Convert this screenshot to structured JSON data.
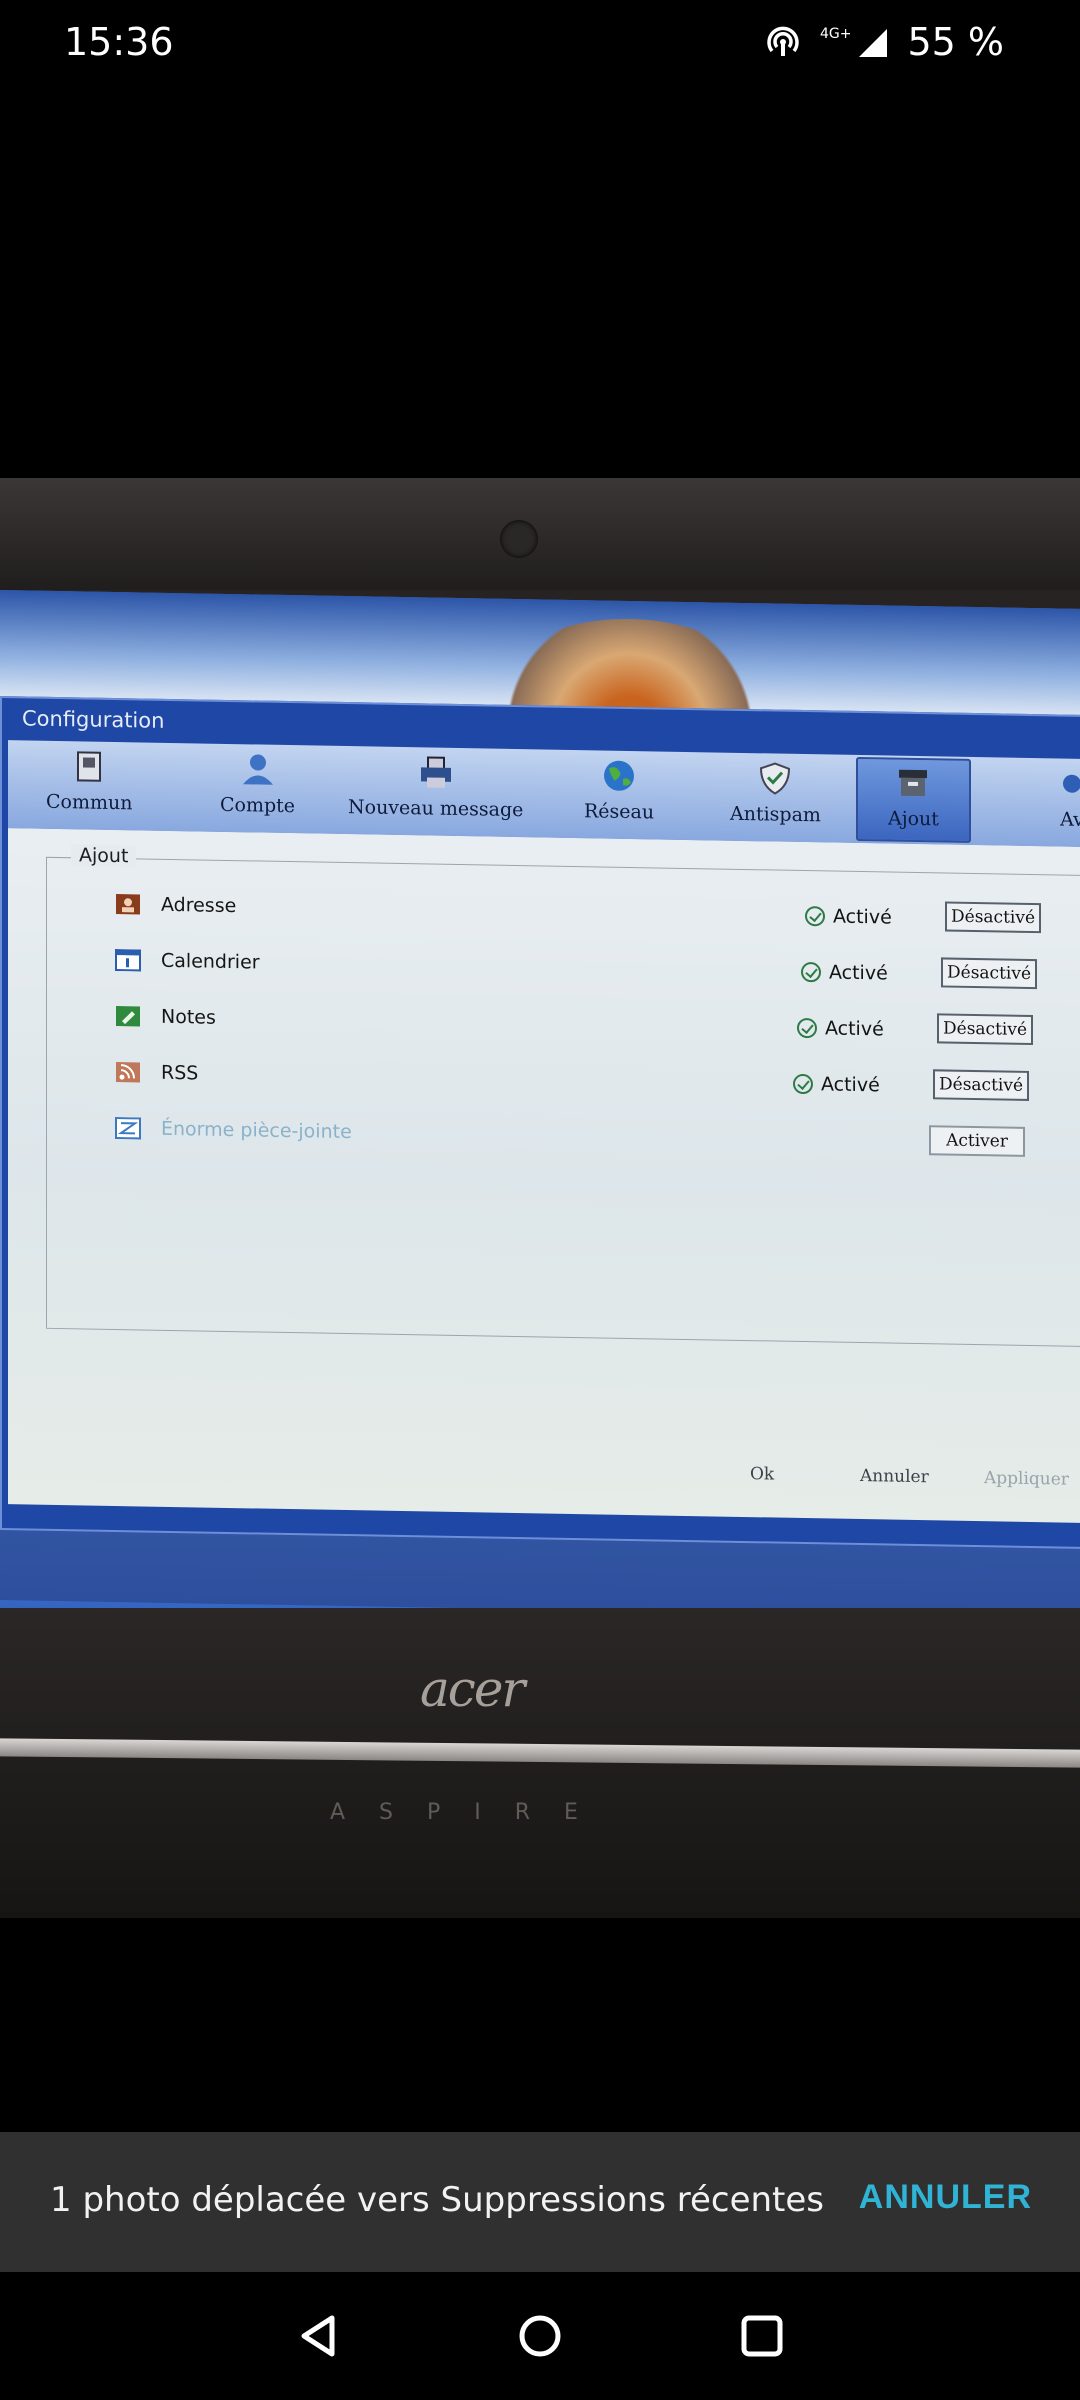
{
  "status_bar": {
    "time": "15:36",
    "network": "4G+",
    "battery": "55 %"
  },
  "window": {
    "title": "Configuration",
    "toolbar": [
      {
        "label": "Commun",
        "icon": "general-icon"
      },
      {
        "label": "Compte",
        "icon": "user-icon"
      },
      {
        "label": "Nouveau message",
        "icon": "printer-icon"
      },
      {
        "label": "Réseau",
        "icon": "globe-icon"
      },
      {
        "label": "Antispam",
        "icon": "shield-icon"
      },
      {
        "label": "Ajout",
        "icon": "archive-icon",
        "active": true
      },
      {
        "label": "Av",
        "icon": "advanced-icon"
      }
    ],
    "group_title": "Ajout",
    "addons": [
      {
        "name": "Adresse",
        "status": "Activé",
        "button": "Désactivé",
        "icon": "address-book-icon",
        "color": "#8a3b1c"
      },
      {
        "name": "Calendrier",
        "status": "Activé",
        "button": "Désactivé",
        "icon": "calendar-icon",
        "color": "#2a5fb0"
      },
      {
        "name": "Notes",
        "status": "Activé",
        "button": "Désactivé",
        "icon": "notes-icon",
        "color": "#2f8a3e"
      },
      {
        "name": "RSS",
        "status": "Activé",
        "button": "Désactivé",
        "icon": "rss-icon",
        "color": "#c0785a"
      },
      {
        "name": "Énorme pièce-jointe",
        "status": "",
        "button": "Activer",
        "icon": "attachment-icon",
        "color": "#3d78c4",
        "disabled": true
      }
    ],
    "footer": {
      "ok": "Ok",
      "cancel": "Annuler",
      "apply": "Appliquer"
    }
  },
  "laptop": {
    "brand": "acer",
    "model": "ASPIRE"
  },
  "snackbar": {
    "message": "1 photo déplacée vers Suppressions récentes",
    "action": "ANNULER",
    "action_color": "#2fb4d6"
  }
}
